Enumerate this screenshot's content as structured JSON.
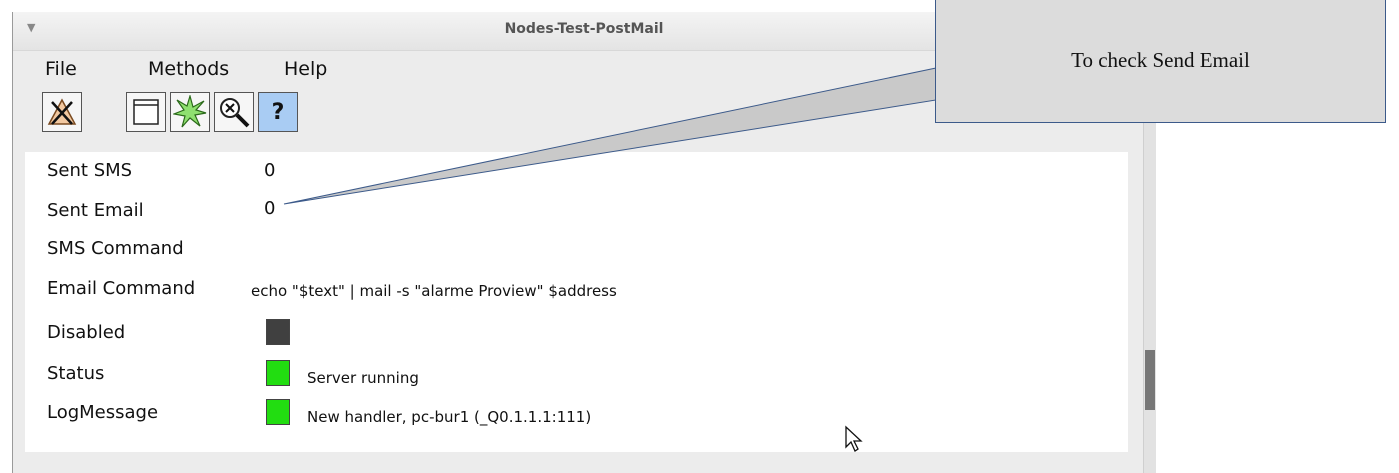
{
  "window": {
    "title": "Nodes-Test-PostMail",
    "menu_arrow_icon": "triangle-down-icon"
  },
  "menu": {
    "file": "File",
    "methods": "Methods",
    "help": "Help"
  },
  "toolbar": {
    "icons": [
      "close-graph-icon",
      "open-window-icon",
      "star-burst-icon",
      "zoom-x-icon",
      "help-icon"
    ],
    "help_label": "?"
  },
  "fields": {
    "sent_sms": {
      "label": "Sent SMS",
      "value": "0"
    },
    "sent_email": {
      "label": "Sent Email",
      "value": "0"
    },
    "sms_command": {
      "label": "SMS Command",
      "value": ""
    },
    "email_command": {
      "label": "Email Command",
      "value": "echo \"$text\" | mail -s \"alarme Proview\" $address"
    },
    "disabled": {
      "label": "Disabled",
      "indicator_color": "#404040"
    },
    "status": {
      "label": "Status",
      "indicator_color": "#22dd11",
      "text": "Server running"
    },
    "log_message": {
      "label": "LogMessage",
      "indicator_color": "#22dd11",
      "text": "New handler, pc-bur1 (_Q0.1.1.1:111)"
    }
  },
  "callout": {
    "text": "To check Send Email"
  }
}
